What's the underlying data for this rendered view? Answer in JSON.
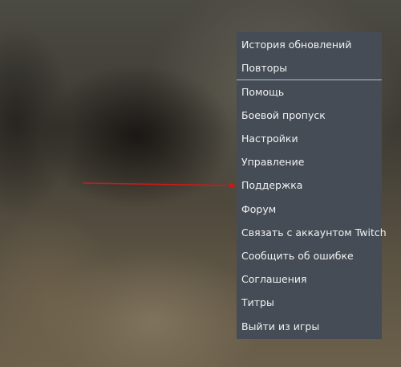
{
  "menu": {
    "items": [
      {
        "label": "История обновлений"
      },
      {
        "label": "Повторы"
      },
      {
        "label": "Помощь"
      },
      {
        "label": "Боевой пропуск"
      },
      {
        "label": "Настройки"
      },
      {
        "label": "Управление"
      },
      {
        "label": "Поддержка"
      },
      {
        "label": "Форум"
      },
      {
        "label": "Связать с аккаунтом Twitch"
      },
      {
        "label": "Сообщить об ошибке"
      },
      {
        "label": "Соглашения"
      },
      {
        "label": "Титры"
      },
      {
        "label": "Выйти из игры"
      }
    ]
  },
  "colors": {
    "menu_background": "#454c55",
    "menu_text": "#f2f2f2",
    "divider": "#b9bec4",
    "arrow": "#d01818"
  }
}
